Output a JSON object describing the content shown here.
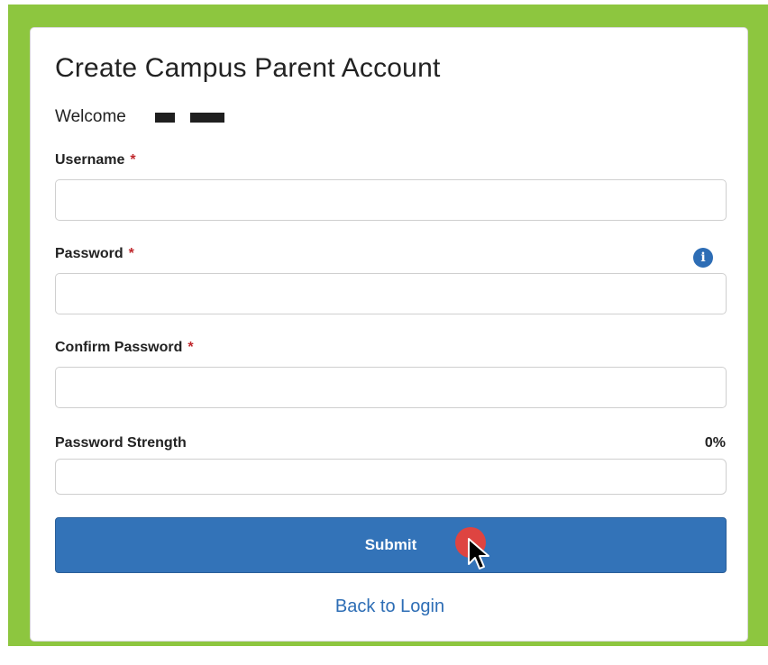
{
  "form": {
    "title": "Create Campus Parent Account",
    "welcome": "Welcome",
    "required_mark": "*",
    "username": {
      "label": "Username",
      "value": "",
      "placeholder": ""
    },
    "password": {
      "label": "Password",
      "value": "",
      "placeholder": "",
      "info_icon": "info-circle-icon"
    },
    "confirm_password": {
      "label": "Confirm Password",
      "value": "",
      "placeholder": ""
    },
    "password_strength": {
      "label": "Password Strength",
      "value_text": "0%",
      "value": 0
    },
    "submit_label": "Submit",
    "back_link": "Back to Login"
  },
  "colors": {
    "frame_green": "#8dc63f",
    "primary_blue": "#3373b8",
    "link_blue": "#2d6db5",
    "required_red": "#c0282d",
    "click_marker": "#e8413a"
  },
  "icons": {
    "info": "info-circle-icon",
    "cursor": "mouse-pointer-icon",
    "click": "click-indicator-icon"
  }
}
